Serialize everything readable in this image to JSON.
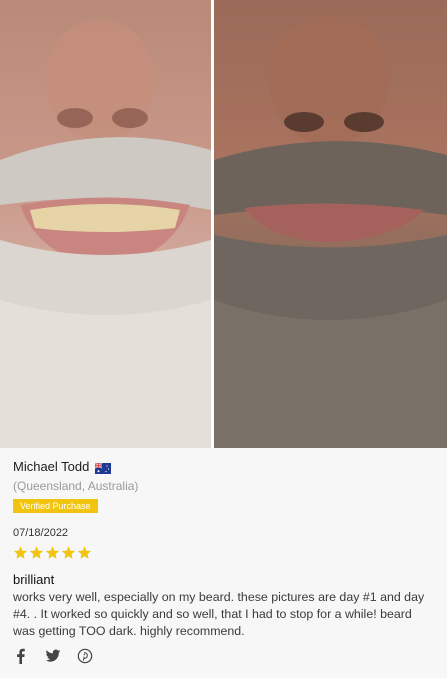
{
  "review": {
    "reviewer_name": "Michael Todd",
    "flag_icon": "australia-flag-icon",
    "location": "(Queensland, Australia)",
    "badge": "Verified Purchase",
    "date": "07/18/2022",
    "rating": 5,
    "max_rating": 5,
    "title": "brilliant",
    "body": "works very well, especially on my beard. these pictures are day #1 and day #4. . It worked so quickly and so well, that I had to stop for a while! beard was getting TOO dark. highly recommend."
  },
  "photos": [
    {
      "name": "before-photo"
    },
    {
      "name": "after-photo"
    }
  ],
  "share": {
    "icons": [
      "facebook-icon",
      "twitter-icon",
      "pinterest-icon"
    ]
  },
  "colors": {
    "badge": "#f1c40f",
    "star": "#f1c40f",
    "location": "#9a9a9a"
  }
}
